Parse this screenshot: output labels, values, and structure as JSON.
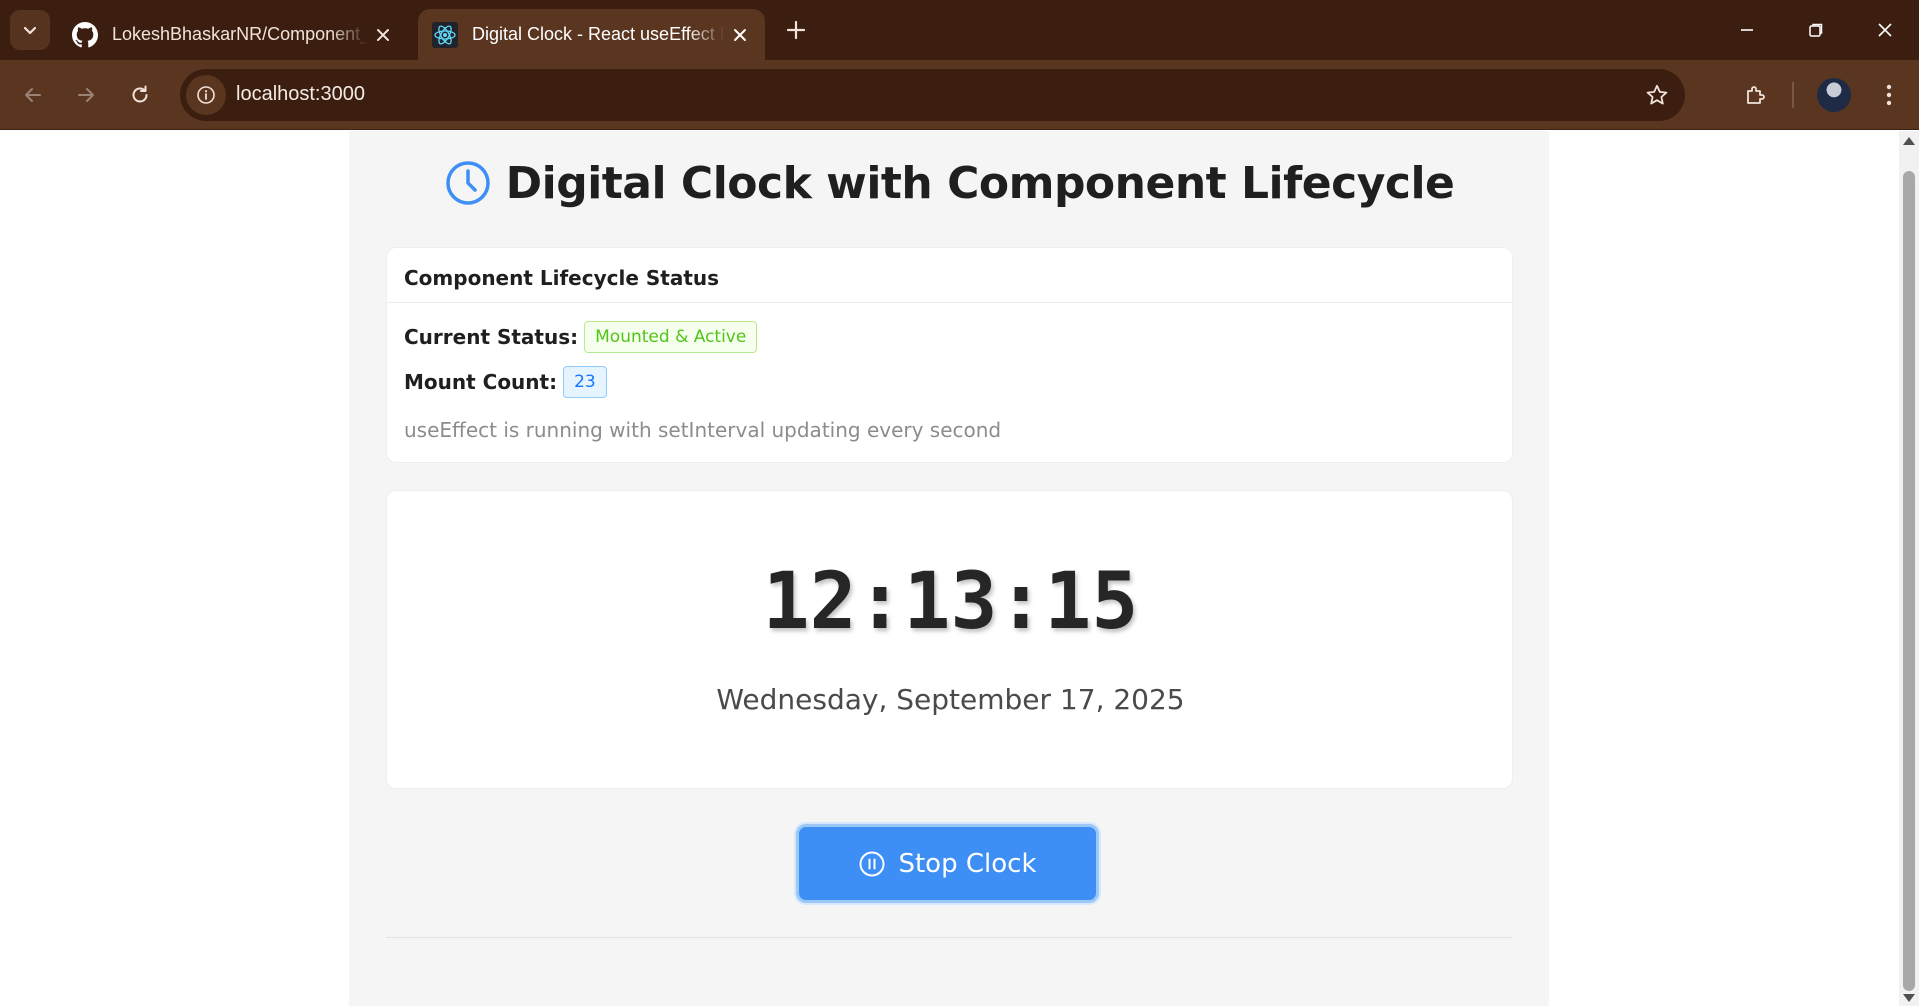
{
  "browser": {
    "tabs": [
      {
        "title": "LokeshBhaskarNR/Component_",
        "favicon": "github-icon",
        "active": false
      },
      {
        "title": "Digital Clock - React useEffect D",
        "favicon": "react-icon",
        "active": true
      }
    ],
    "address": "localhost:3000"
  },
  "page": {
    "title": "Digital Clock with Component Lifecycle",
    "status_card": {
      "header": "Component Lifecycle Status",
      "status_label": "Current Status:",
      "status_value": "Mounted & Active",
      "mount_label": "Mount Count:",
      "mount_value": "23",
      "note": "useEffect is running with setInterval updating every second"
    },
    "clock": {
      "hours": "12",
      "minutes": "13",
      "seconds": "15",
      "separator": ":",
      "date": "Wednesday, September 17, 2025"
    },
    "stop_button": "Stop Clock"
  },
  "colors": {
    "chrome_dark": "#3b1e10",
    "chrome_toolbar": "#5a3520",
    "accent_blue": "#3d8ff5",
    "status_green": "#52c41a",
    "count_blue": "#1677ff"
  }
}
